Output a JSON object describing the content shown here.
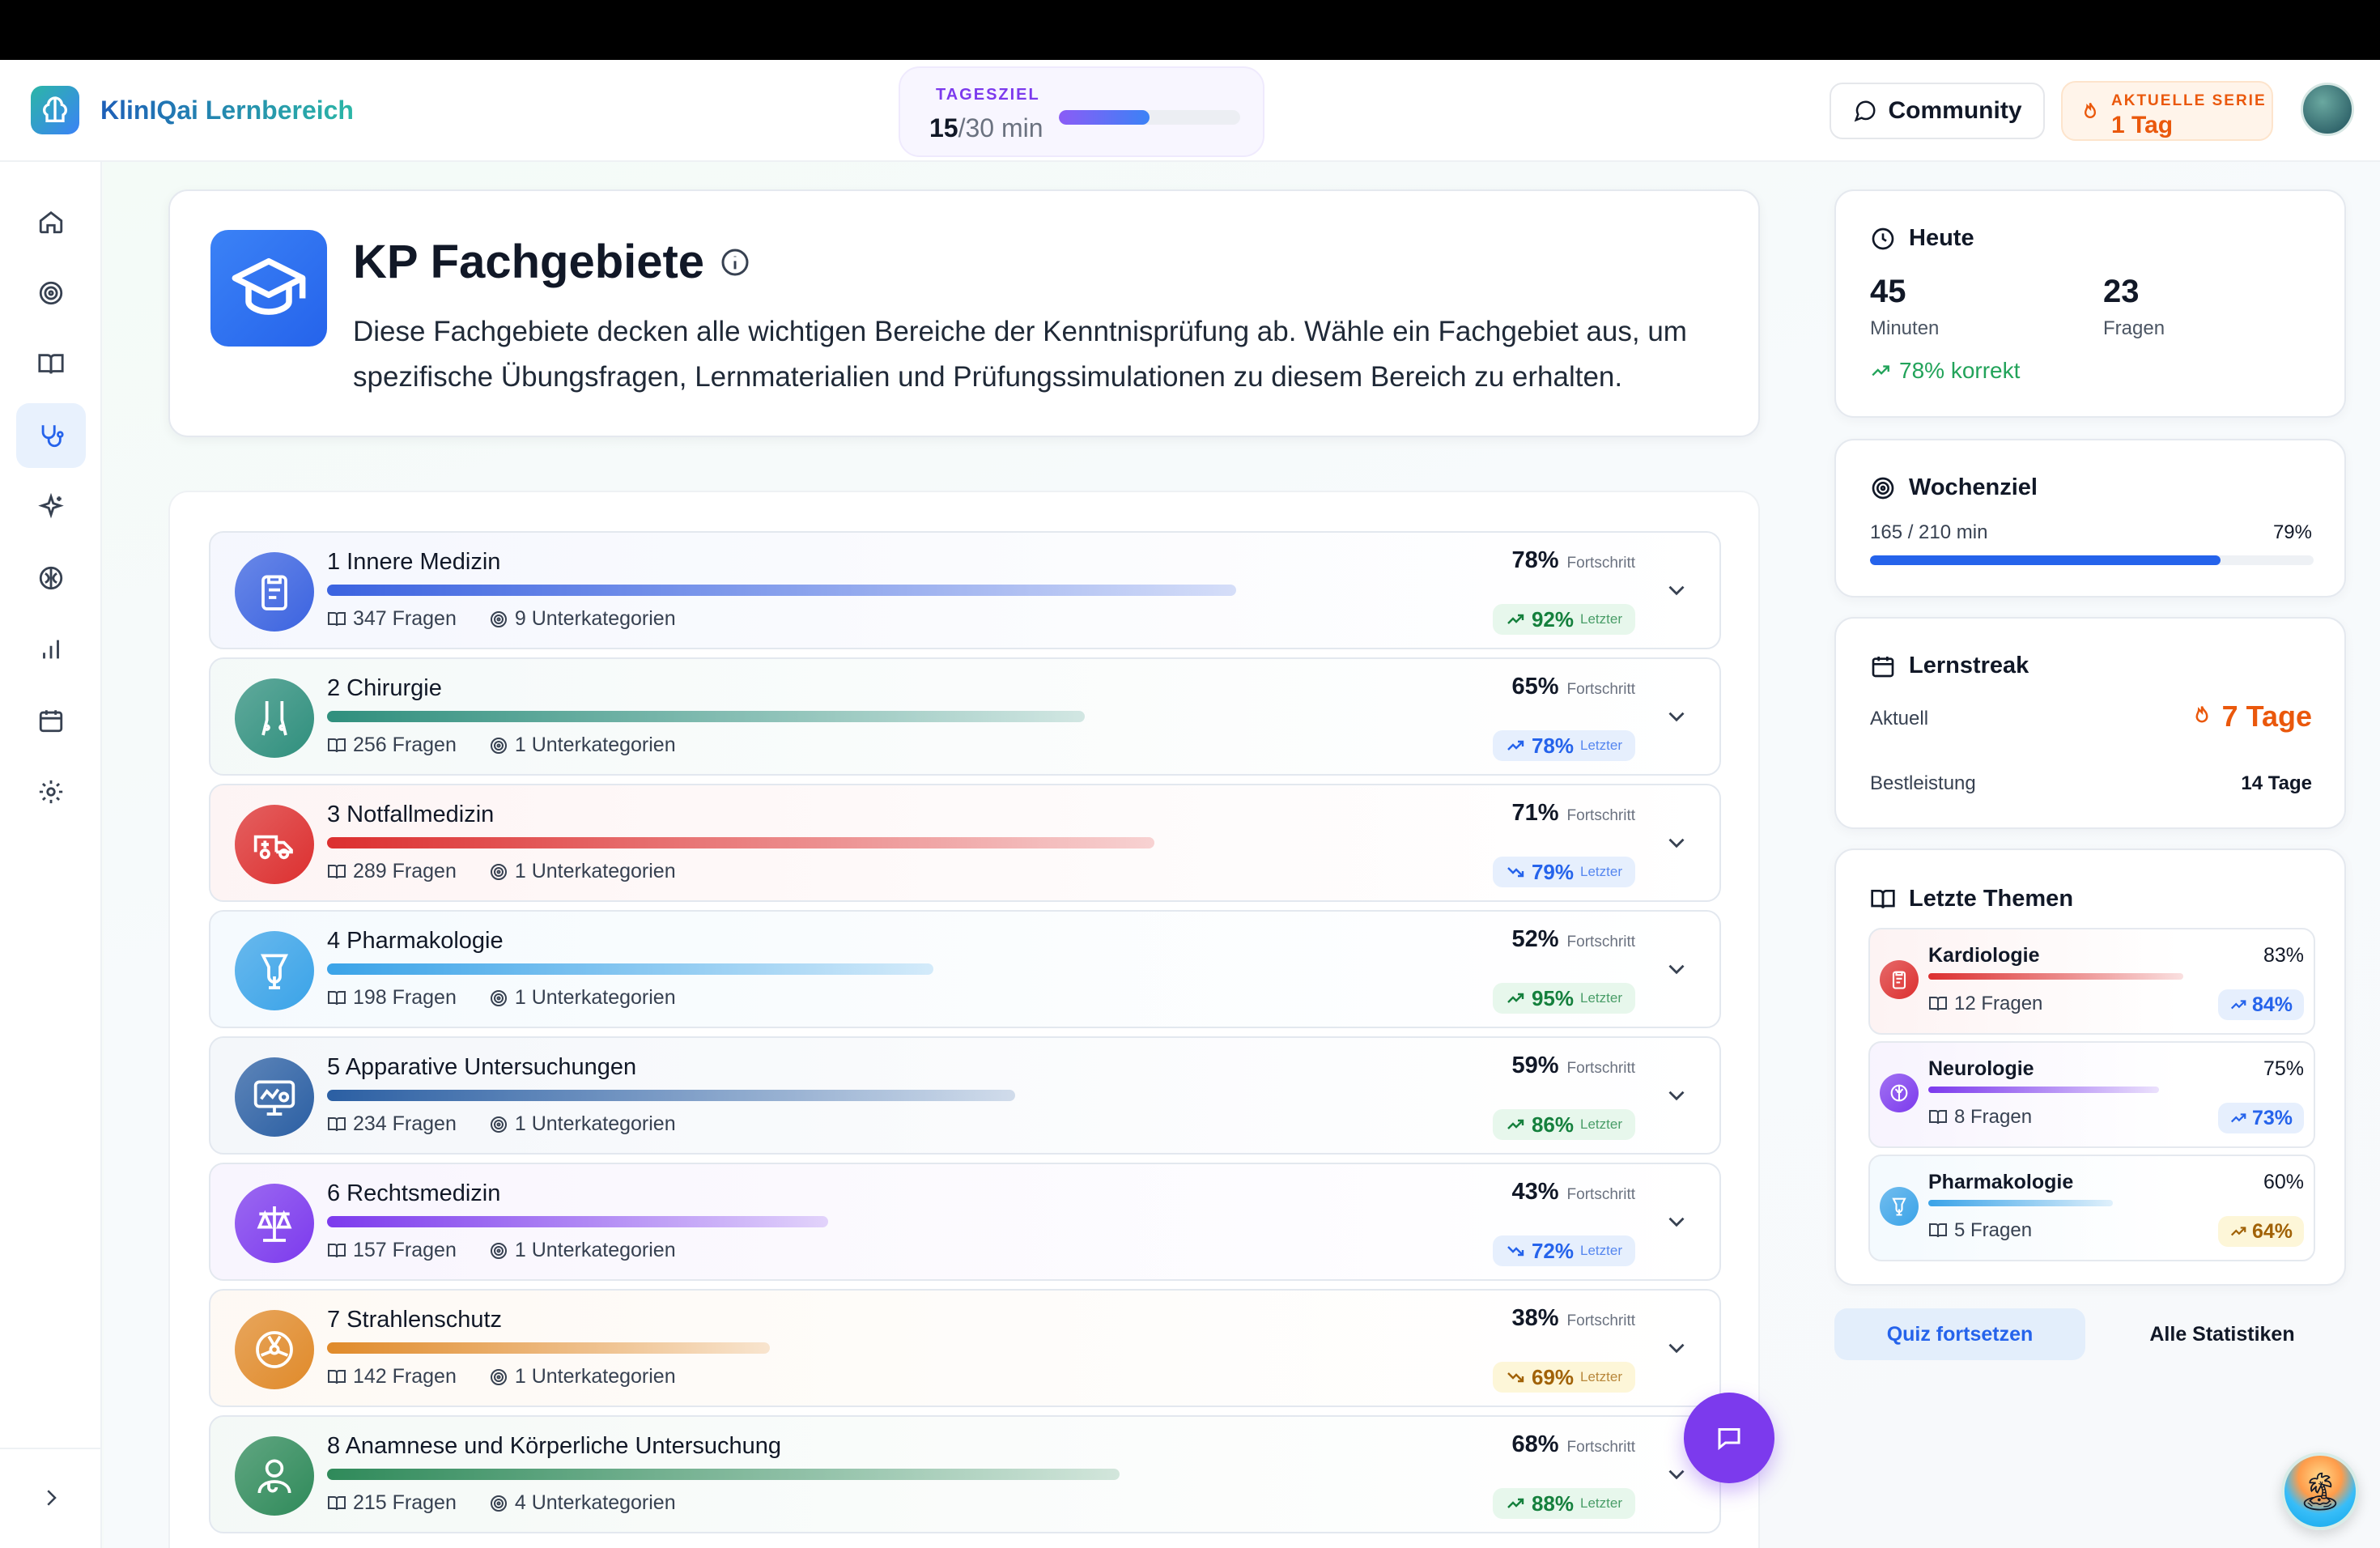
{
  "app": {
    "title": "KlinIQai Lernbereich"
  },
  "header": {
    "goal_label": "TAGESZIEL",
    "goal_done": "15",
    "goal_total": "/30 min",
    "goal_fraction": 0.5,
    "community_label": "Community",
    "streak_label": "AKTUELLE SERIE",
    "streak_value": "1 Tag"
  },
  "sidebar": {
    "items": [
      {
        "name": "home-icon"
      },
      {
        "name": "target-icon"
      },
      {
        "name": "book-icon"
      },
      {
        "name": "stethoscope-icon",
        "active": true
      },
      {
        "name": "sparkle-icon"
      },
      {
        "name": "brain-icon"
      },
      {
        "name": "bar-chart-icon"
      },
      {
        "name": "calendar-icon"
      },
      {
        "name": "gear-icon"
      }
    ],
    "expand_icon": "chevron-right-icon"
  },
  "hero": {
    "title": "KP Fachgebiete",
    "description": "Diese Fachgebiete decken alle wichtigen Bereiche der Kenntnisprüfung ab. Wähle ein Fachgebiet aus, um spezifische Übungsfragen, Lernmaterialien und Prüfungssimulationen zu diesem Bereich zu erhalten."
  },
  "fachgebiete": [
    {
      "name": "1 Innere Medizin",
      "questions": "347 Fragen",
      "subcats": "9 Unterkategorien",
      "progress": "78%",
      "progress_label": "Fortschritt",
      "last": "92%",
      "last_label": "Letzter",
      "trend": "up",
      "progress_value": 78,
      "color": "#3b63e0",
      "icon": "clipboard-icon"
    },
    {
      "name": "2 Chirurgie",
      "questions": "256 Fragen",
      "subcats": "1 Unterkategorien",
      "progress": "65%",
      "progress_label": "Fortschritt",
      "last": "78%",
      "last_label": "Letzter",
      "trend": "up",
      "progress_value": 65,
      "color": "#2f8f7d",
      "icon": "scalpel-icon"
    },
    {
      "name": "3 Notfallmedizin",
      "questions": "289 Fragen",
      "subcats": "1 Unterkategorien",
      "progress": "71%",
      "progress_label": "Fortschritt",
      "last": "79%",
      "last_label": "Letzter",
      "trend": "down",
      "progress_value": 71,
      "color": "#dc2f2f",
      "icon": "ambulance-icon"
    },
    {
      "name": "4 Pharmakologie",
      "questions": "198 Fragen",
      "subcats": "1 Unterkategorien",
      "progress": "52%",
      "progress_label": "Fortschritt",
      "last": "95%",
      "last_label": "Letzter",
      "trend": "up",
      "progress_value": 52,
      "color": "#3aa3e8",
      "icon": "pharmacy-icon"
    },
    {
      "name": "5 Apparative Untersuchungen",
      "questions": "234 Fragen",
      "subcats": "1 Unterkategorien",
      "progress": "59%",
      "progress_label": "Fortschritt",
      "last": "86%",
      "last_label": "Letzter",
      "trend": "up",
      "progress_value": 59,
      "color": "#2b5fa3",
      "icon": "monitor-icon"
    },
    {
      "name": "6 Rechtsmedizin",
      "questions": "157 Fragen",
      "subcats": "1 Unterkategorien",
      "progress": "43%",
      "progress_label": "Fortschritt",
      "last": "72%",
      "last_label": "Letzter",
      "trend": "down",
      "progress_value": 43,
      "color": "#7c3aed",
      "icon": "scale-icon"
    },
    {
      "name": "7 Strahlenschutz",
      "questions": "142 Fragen",
      "subcats": "1 Unterkategorien",
      "progress": "38%",
      "progress_label": "Fortschritt",
      "last": "69%",
      "last_label": "Letzter",
      "trend": "down",
      "progress_value": 38,
      "color": "#e08a2a",
      "icon": "radiation-icon"
    },
    {
      "name": "8 Anamnese und Körperliche Untersuchung",
      "questions": "215 Fragen",
      "subcats": "4 Unterkategorien",
      "progress": "68%",
      "progress_label": "Fortschritt",
      "last": "88%",
      "last_label": "Letzter",
      "trend": "up",
      "progress_value": 68,
      "color": "#2f8a5a",
      "icon": "doctor-icon"
    }
  ],
  "heute": {
    "title": "Heute",
    "minutes": "45",
    "minutes_label": "Minuten",
    "questions": "23",
    "questions_label": "Fragen",
    "correct": "78% korrekt"
  },
  "wochenziel": {
    "title": "Wochenziel",
    "value": "165 / 210 min",
    "pct": "79%",
    "fraction": 0.79
  },
  "lernstreak": {
    "title": "Lernstreak",
    "current_label": "Aktuell",
    "current_value": "7 Tage",
    "best_label": "Bestleistung",
    "best_value": "14 Tage"
  },
  "letzte_themen": {
    "title": "Letzte Themen",
    "items": [
      {
        "name": "Kardiologie",
        "pct": "83%",
        "progress_value": 83,
        "questions": "12 Fragen",
        "last": "84%",
        "color": "#dc2f2f",
        "icon": "clipboard-icon"
      },
      {
        "name": "Neurologie",
        "pct": "75%",
        "progress_value": 75,
        "questions": "8 Fragen",
        "last": "73%",
        "color": "#7c3aed",
        "icon": "brain-icon"
      },
      {
        "name": "Pharmakologie",
        "pct": "60%",
        "progress_value": 60,
        "questions": "5 Fragen",
        "last": "64%",
        "color": "#3aa3e8",
        "icon": "pharmacy-icon"
      }
    ]
  },
  "actions": {
    "quiz": "Quiz fortsetzen",
    "stats": "Alle Statistiken"
  }
}
